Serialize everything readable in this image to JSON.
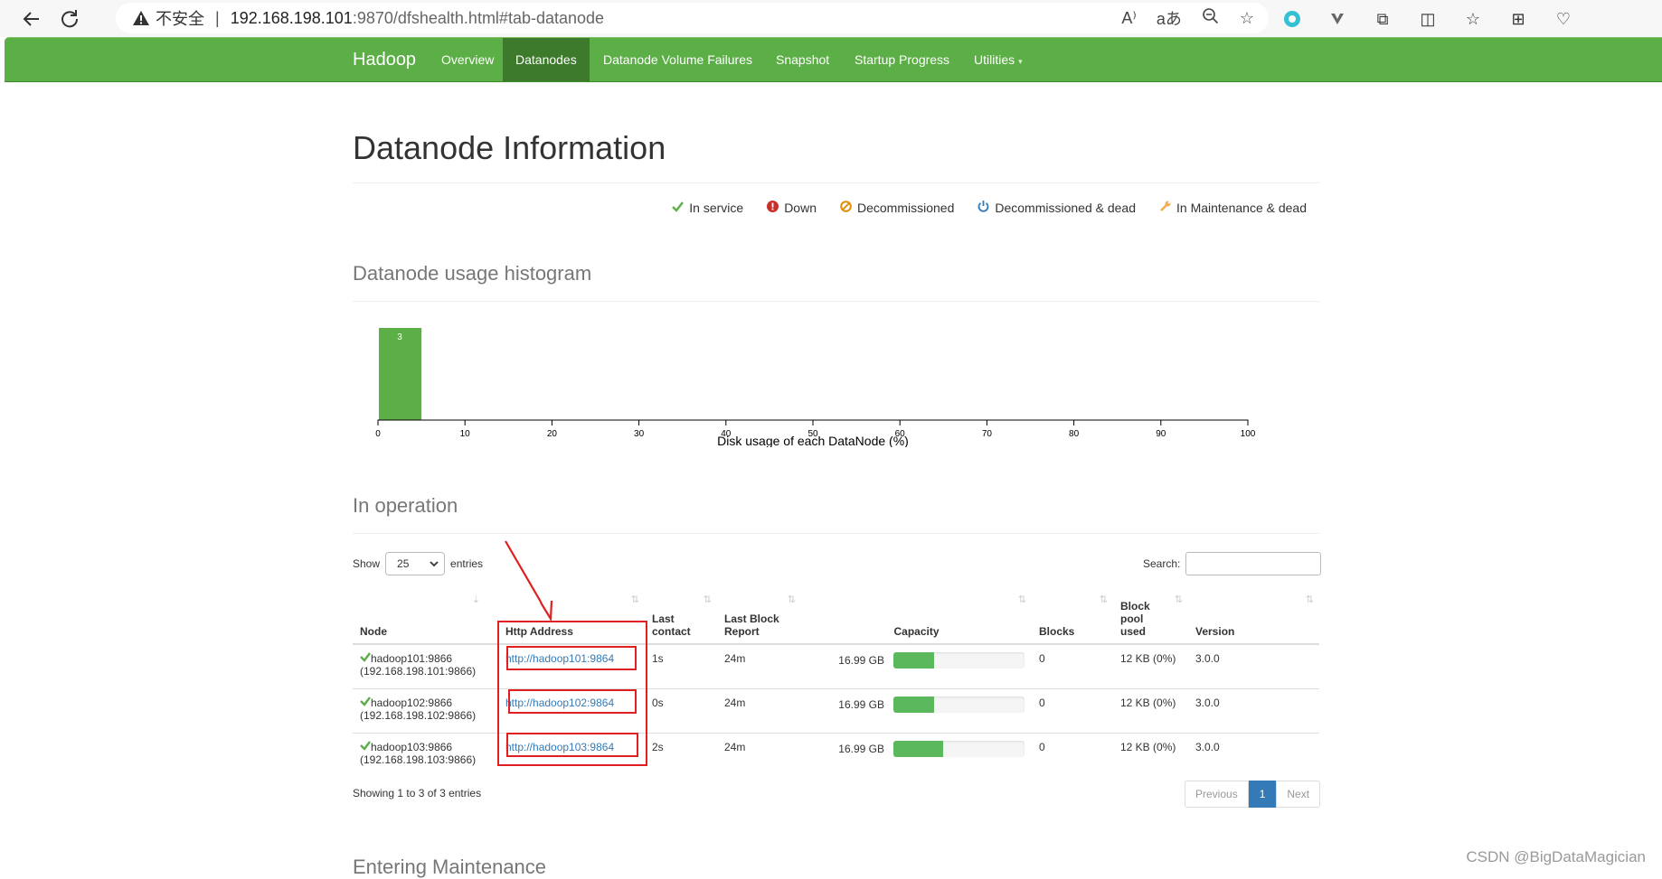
{
  "browser": {
    "insecure_label": "不安全",
    "url_host": "192.168.198.101",
    "url_path": ":9870/dfshealth.html#tab-datanode"
  },
  "navbar": {
    "brand": "Hadoop",
    "items": [
      {
        "label": "Overview"
      },
      {
        "label": "Datanodes"
      },
      {
        "label": "Datanode Volume Failures"
      },
      {
        "label": "Snapshot"
      },
      {
        "label": "Startup Progress"
      },
      {
        "label": "Utilities"
      }
    ],
    "colors": {
      "bar": "#5cae46",
      "active": "#3d7a2c"
    }
  },
  "page_title": "Datanode Information",
  "legend": [
    {
      "label": "In service",
      "icon": "check-icon"
    },
    {
      "label": "Down",
      "icon": "exclamation-circle-icon"
    },
    {
      "label": "Decommissioned",
      "icon": "ban-icon"
    },
    {
      "label": "Decommissioned & dead",
      "icon": "power-icon"
    },
    {
      "label": "In Maintenance & dead",
      "icon": "wrench-icon"
    }
  ],
  "histogram_section": "Datanode usage histogram",
  "chart_data": {
    "type": "bar",
    "title": "",
    "xlabel": "Disk usage of each DataNode (%)",
    "ylabel": "",
    "xlim": [
      0,
      100
    ],
    "ticks": [
      0,
      10,
      20,
      30,
      40,
      50,
      60,
      70,
      80,
      90,
      100
    ],
    "bins": [
      {
        "x0": 0,
        "x1": 5,
        "count": 3
      }
    ],
    "grid": false
  },
  "operation_section": "In operation",
  "table_controls": {
    "show_label": "Show",
    "entries_value": "25",
    "entries_label": "entries",
    "search_label": "Search:"
  },
  "table": {
    "headers": [
      "Node",
      "Http Address",
      "Last contact",
      "Last Block Report",
      "Capacity",
      "Blocks",
      "Block pool used",
      "Version"
    ],
    "header_lines": {
      "last_contact": [
        "Last",
        "contact"
      ],
      "last_block_report": [
        "Last Block",
        "Report"
      ],
      "block_pool_used": [
        "Block",
        "pool",
        "used"
      ]
    },
    "rows": [
      {
        "node": "hadoop101:9866",
        "ip": "(192.168.198.101:9866)",
        "http": "http://hadoop101:9864",
        "contact": "1s",
        "report": "24m",
        "capacity": "16.99 GB",
        "used_fraction": 0.31,
        "blocks": "0",
        "pool": "12 KB (0%)",
        "version": "3.0.0"
      },
      {
        "node": "hadoop102:9866",
        "ip": "(192.168.198.102:9866)",
        "http": "http://hadoop102:9864",
        "contact": "0s",
        "report": "24m",
        "capacity": "16.99 GB",
        "used_fraction": 0.31,
        "blocks": "0",
        "pool": "12 KB (0%)",
        "version": "3.0.0"
      },
      {
        "node": "hadoop103:9866",
        "ip": "(192.168.198.103:9866)",
        "http": "http://hadoop103:9864",
        "contact": "2s",
        "report": "24m",
        "capacity": "16.99 GB",
        "used_fraction": 0.38,
        "blocks": "0",
        "pool": "12 KB (0%)",
        "version": "3.0.0"
      }
    ]
  },
  "table_footer": "Showing 1 to 3 of 3 entries",
  "pagination": {
    "previous": "Previous",
    "current": "1",
    "next": "Next"
  },
  "maintenance_section": "Entering Maintenance",
  "watermark": "CSDN @BigDataMagician"
}
